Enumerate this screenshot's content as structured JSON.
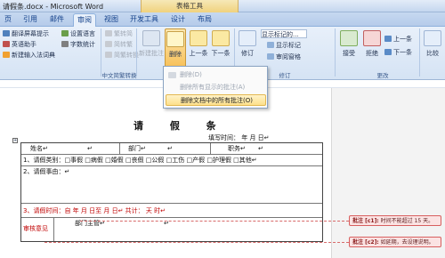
{
  "window": {
    "title": "请假条.docx - Microsoft Word",
    "context_tab": "表格工具"
  },
  "tabs": [
    "页",
    "引用",
    "邮件",
    "审阅",
    "视图",
    "开发工具",
    "设计",
    "布局"
  ],
  "ribbon": {
    "proofing": {
      "translate_tip": "翻译屏幕提示",
      "translate_tip_suffix": "·",
      "set_language": "设置语言",
      "research": "英语助手",
      "word_count": "字数统计",
      "new_input_method": "新建输入法词典"
    },
    "chinese": {
      "label": "中文简繁转换",
      "trad_simp": "繁转简",
      "simp_trad": "简转繁",
      "convert": "简繁转换"
    },
    "comments": {
      "new": "新建批注",
      "delete": "删除",
      "prev": "上一条",
      "next": "下一条"
    },
    "tracking": {
      "track": "修订",
      "show_markup": "显示标记的...",
      "show_markup2": "显示标记",
      "review_pane": "审阅窗格",
      "label": "修订"
    },
    "changes": {
      "accept": "接受",
      "reject": "拒绝",
      "prev": "上一条",
      "next": "下一条",
      "label": "更改"
    },
    "compare": {
      "label": "比较"
    }
  },
  "delete_menu": {
    "items": [
      "删除(D)",
      "删除所有显示的批注(A)",
      "删除文档中的所有批注(O)"
    ]
  },
  "document": {
    "title": "请 假 条",
    "fill_date": "填写时间：     年    月    日↵",
    "row1": {
      "name": "姓名↵",
      "mark1": "↵",
      "dept": "部门↵",
      "mark2": "↵",
      "post": "职务↵",
      "mark3": "↵"
    },
    "row2": {
      "text": "1、请假类别：□事假  □病假  □婚假  □丧假  □公假  □工伤  □产假  □护理假  □其他↵"
    },
    "row3": {
      "text": "2、请假事由：↵"
    },
    "row4": {
      "text": "3、请假时间：自      年    月    日至     月    日↵      共计：   天    时↵"
    },
    "row5": {
      "label": "审核意见",
      "dept_head": "部门主管↵",
      "mark": "↵"
    }
  },
  "comments": [
    {
      "tag": "批注 [c1]:",
      "text": "时间不能超过 15 天。"
    },
    {
      "tag": "批注 [c2]:",
      "text": "如延期，去设理说明。"
    }
  ]
}
